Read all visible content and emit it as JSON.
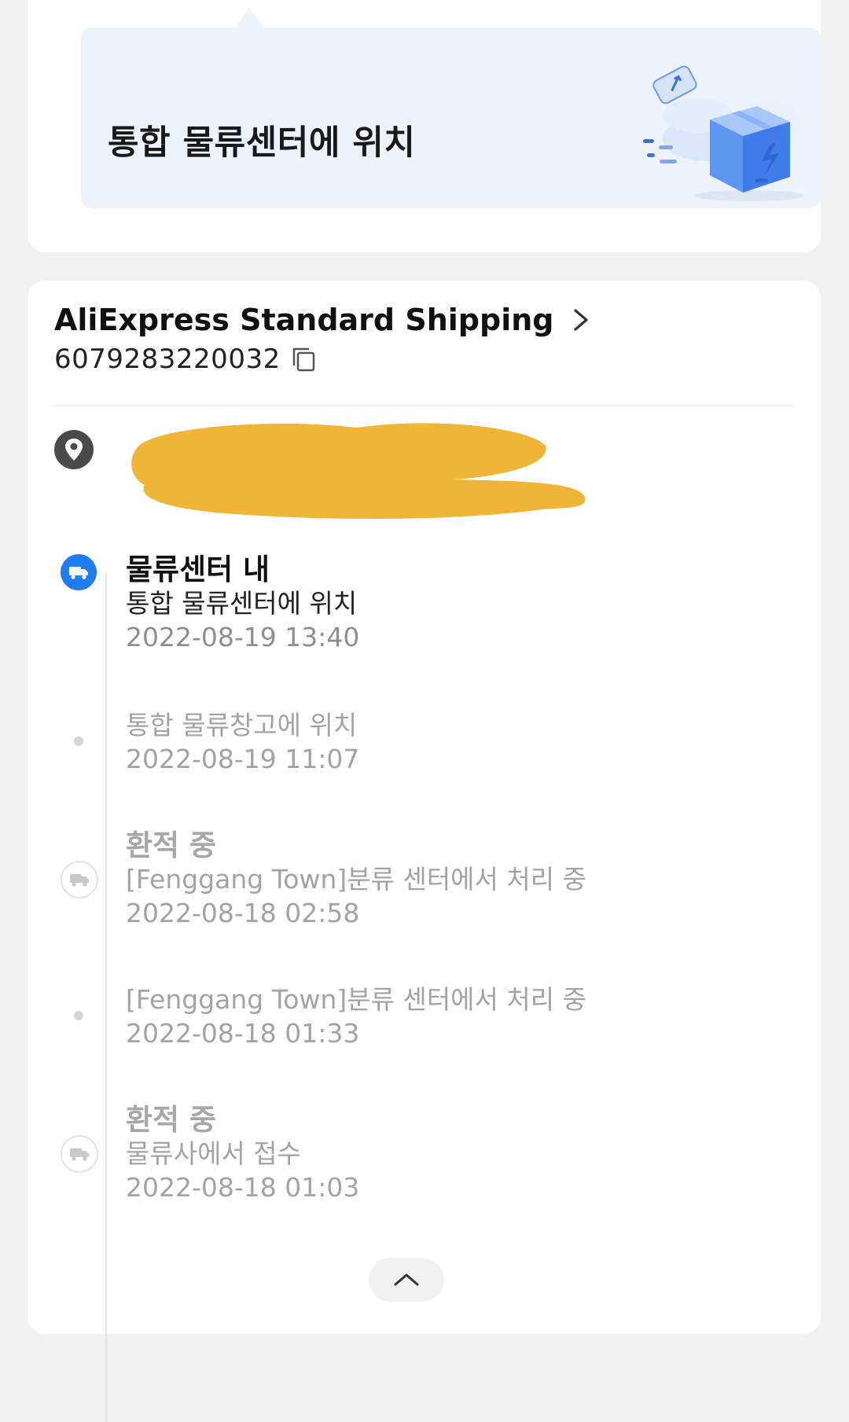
{
  "status_banner": {
    "title": "통합 물류센터에 위치",
    "illustration_icon": "package-delivery-icon"
  },
  "shipment": {
    "carrier_name": "AliExpress Standard Shipping",
    "tracking_number": "6079283220032",
    "carrier_link_icon": "chevron-right-icon",
    "copy_icon": "copy-icon"
  },
  "address": {
    "icon": "location-pin-icon"
  },
  "timeline": [
    {
      "title": "물류센터 내",
      "description": "통합 물류센터에 위치",
      "time": "2022-08-19 13:40",
      "state": "active",
      "icon": "truck-icon"
    },
    {
      "title": "",
      "description": "통합 물류창고에 위치",
      "time": "2022-08-19 11:07",
      "state": "dot"
    },
    {
      "title": "환적 중",
      "description": "[Fenggang Town]분류 센터에서 처리 중",
      "time": "2022-08-18 02:58",
      "state": "ring",
      "icon": "truck-icon"
    },
    {
      "title": "",
      "description": "[Fenggang Town]분류 센터에서 처리 중",
      "time": "2022-08-18 01:33",
      "state": "dot"
    },
    {
      "title": "환적 중",
      "description": "물류사에서 접수",
      "time": "2022-08-18 01:03",
      "state": "ring",
      "icon": "truck-icon"
    }
  ],
  "collapse_icon": "chevron-up-icon",
  "colors": {
    "accent": "#1f7df0",
    "banner_bg": "#eef3fb",
    "redaction": "#f0b536",
    "page_bg": "#f2f2f2"
  }
}
